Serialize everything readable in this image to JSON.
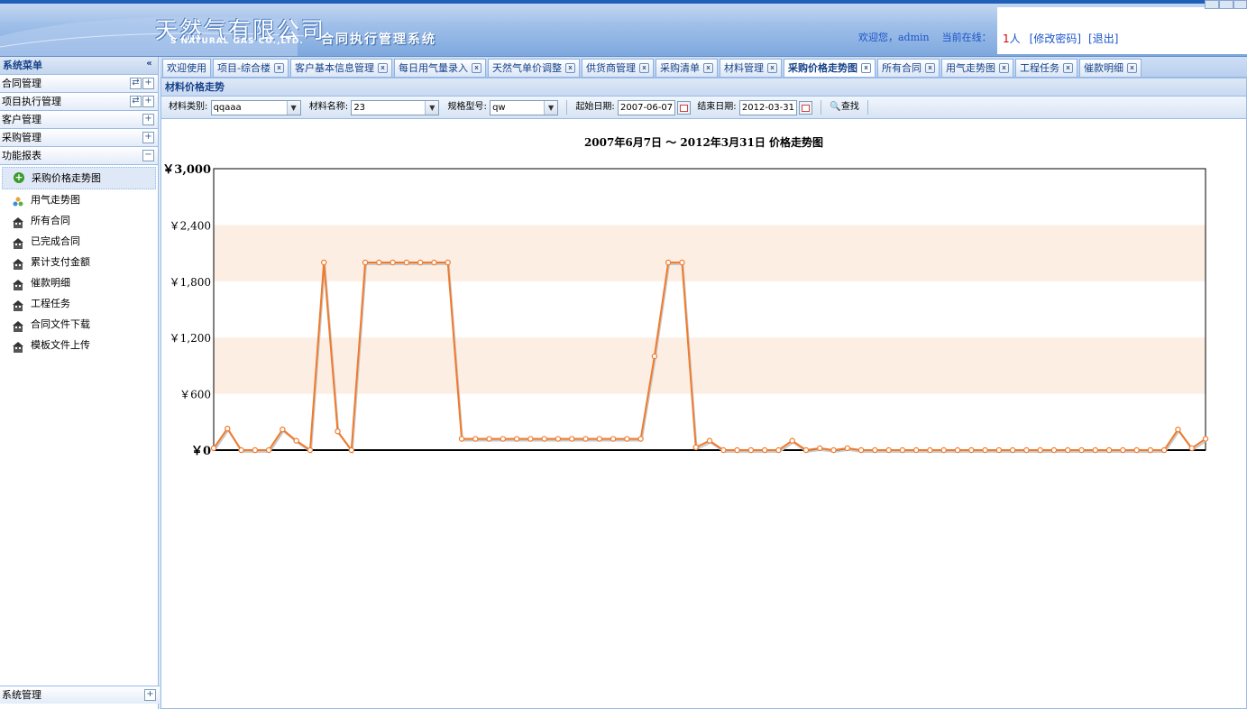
{
  "header": {
    "company_cn": "天然气有限公司",
    "company_en": "S NATURAL GAS CO.,LTD.",
    "system_name": "合同执行管理系统",
    "welcome_prefix": "欢迎您，",
    "user": "admin",
    "online_label": "当前在线：",
    "online_count": "1",
    "online_unit": "人",
    "change_password": "[修改密码]",
    "logout": "[退出]"
  },
  "sidebar": {
    "title": "系统菜单",
    "collapse_glyph": "«",
    "sections": [
      {
        "label": "合同管理",
        "btn": "+"
      },
      {
        "label": "项目执行管理",
        "btn": "+"
      },
      {
        "label": "客户管理",
        "btn": "+"
      },
      {
        "label": "采购管理",
        "btn": "+"
      },
      {
        "label": "功能报表",
        "btn": "−"
      }
    ],
    "report_items": [
      {
        "label": "采购价格走势图",
        "icon": "add-circle-icon"
      },
      {
        "label": "用气走势图",
        "icon": "people-icon"
      },
      {
        "label": "所有合同",
        "icon": "building-icon"
      },
      {
        "label": "已完成合同",
        "icon": "building-icon"
      },
      {
        "label": "累计支付金额",
        "icon": "building-icon"
      },
      {
        "label": "催款明细",
        "icon": "building-icon"
      },
      {
        "label": "工程任务",
        "icon": "building-icon"
      },
      {
        "label": "合同文件下载",
        "icon": "building-icon"
      },
      {
        "label": "模板文件上传",
        "icon": "building-icon"
      }
    ],
    "footer_section": {
      "label": "系统管理",
      "btn": "+"
    }
  },
  "tabs": [
    {
      "label": "欢迎使用",
      "closable": false
    },
    {
      "label": "项目-综合楼",
      "closable": true
    },
    {
      "label": "客户基本信息管理",
      "closable": true
    },
    {
      "label": "每日用气量录入",
      "closable": true
    },
    {
      "label": "天然气单价调整",
      "closable": true
    },
    {
      "label": "供货商管理",
      "closable": true
    },
    {
      "label": "采购清单",
      "closable": true
    },
    {
      "label": "材料管理",
      "closable": true
    },
    {
      "label": "采购价格走势图",
      "closable": true,
      "active": true
    },
    {
      "label": "所有合同",
      "closable": true
    },
    {
      "label": "用气走势图",
      "closable": true
    },
    {
      "label": "工程任务",
      "closable": true
    },
    {
      "label": "催款明细",
      "closable": true
    }
  ],
  "panel": {
    "title": "材料价格走势",
    "filters": {
      "category_label": "材料类别:",
      "category_value": "qqaaa",
      "name_label": "材料名称:",
      "name_value": "23",
      "spec_label": "规格型号:",
      "spec_value": "qw",
      "start_label": "起始日期:",
      "start_value": "2007-06-07",
      "end_label": "结束日期:",
      "end_value": "2012-03-31",
      "search_label": "查找"
    }
  },
  "colors": {
    "line": "#f07a2c",
    "band": "#fdeee4"
  },
  "chart_data": {
    "type": "line",
    "title": "2007年6月7日 ～ 2012年3月31日  价格走势图",
    "ylim": [
      0,
      3000
    ],
    "yticks": [
      0,
      600,
      1200,
      1800,
      2400,
      3000
    ],
    "ytick_labels": [
      "￥0",
      "￥600",
      "￥1,200",
      "￥1,800",
      "￥2,400",
      "￥3,000"
    ],
    "grid_bands": true,
    "series": [
      {
        "values": [
          20,
          230,
          0,
          0,
          0,
          220,
          100,
          0,
          2000,
          200,
          0,
          2000,
          2000,
          2000,
          2000,
          2000,
          2000,
          2000,
          120,
          120,
          120,
          120,
          120,
          120,
          120,
          120,
          120,
          120,
          120,
          120,
          120,
          120,
          1000,
          2000,
          2000,
          30,
          100,
          0,
          0,
          0,
          0,
          0,
          100,
          0,
          20,
          0,
          20,
          0,
          0,
          0,
          0,
          0,
          0,
          0,
          0,
          0,
          0,
          0,
          0,
          0,
          0,
          0,
          0,
          0,
          0,
          0,
          0,
          0,
          0,
          0,
          220,
          20,
          120
        ]
      }
    ]
  }
}
